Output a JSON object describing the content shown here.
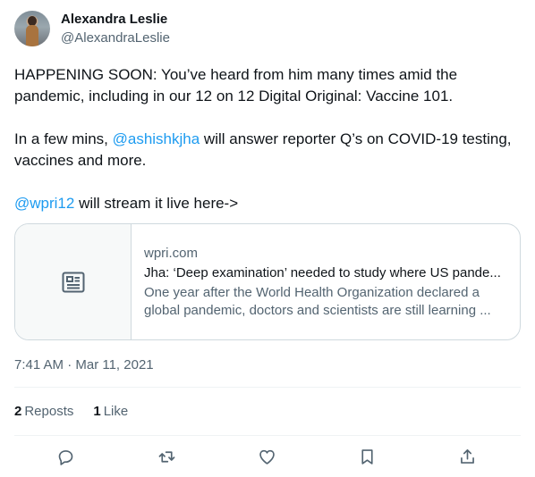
{
  "author": {
    "name": "Alexandra Leslie",
    "handle": "@AlexandraLeslie"
  },
  "tweet": {
    "para1": "HAPPENING SOON: You’ve heard from him many times amid the pandemic, including in our 12 on 12 Digital Original: Vaccine 101.",
    "para2_prefix": "In a few mins, ",
    "para2_mention": "@ashishkjha",
    "para2_suffix": " will answer reporter Q’s on COVID-19 testing, vaccines and more.",
    "para3_mention": "@wpri12",
    "para3_suffix": " will stream it live here->"
  },
  "card": {
    "domain": "wpri.com",
    "title": "Jha: ‘Deep examination’ needed to study where US pande...",
    "description": "One year after the World Health Organization declared a global pandemic, doctors and scientists are still learning ...",
    "thumb_icon": "article-icon"
  },
  "timestamp": "7:41 AM · Mar 11, 2021",
  "stats": {
    "reposts_count": "2",
    "reposts_label": "Reposts",
    "likes_count": "1",
    "likes_label": "Like"
  },
  "actions": [
    {
      "icon": "reply-icon"
    },
    {
      "icon": "repost-icon"
    },
    {
      "icon": "like-icon"
    },
    {
      "icon": "bookmark-icon"
    },
    {
      "icon": "share-icon"
    }
  ],
  "colors": {
    "accent": "#1d9bf0",
    "text_primary": "#0f1419",
    "text_secondary": "#536471",
    "border": "#cfd9de"
  }
}
